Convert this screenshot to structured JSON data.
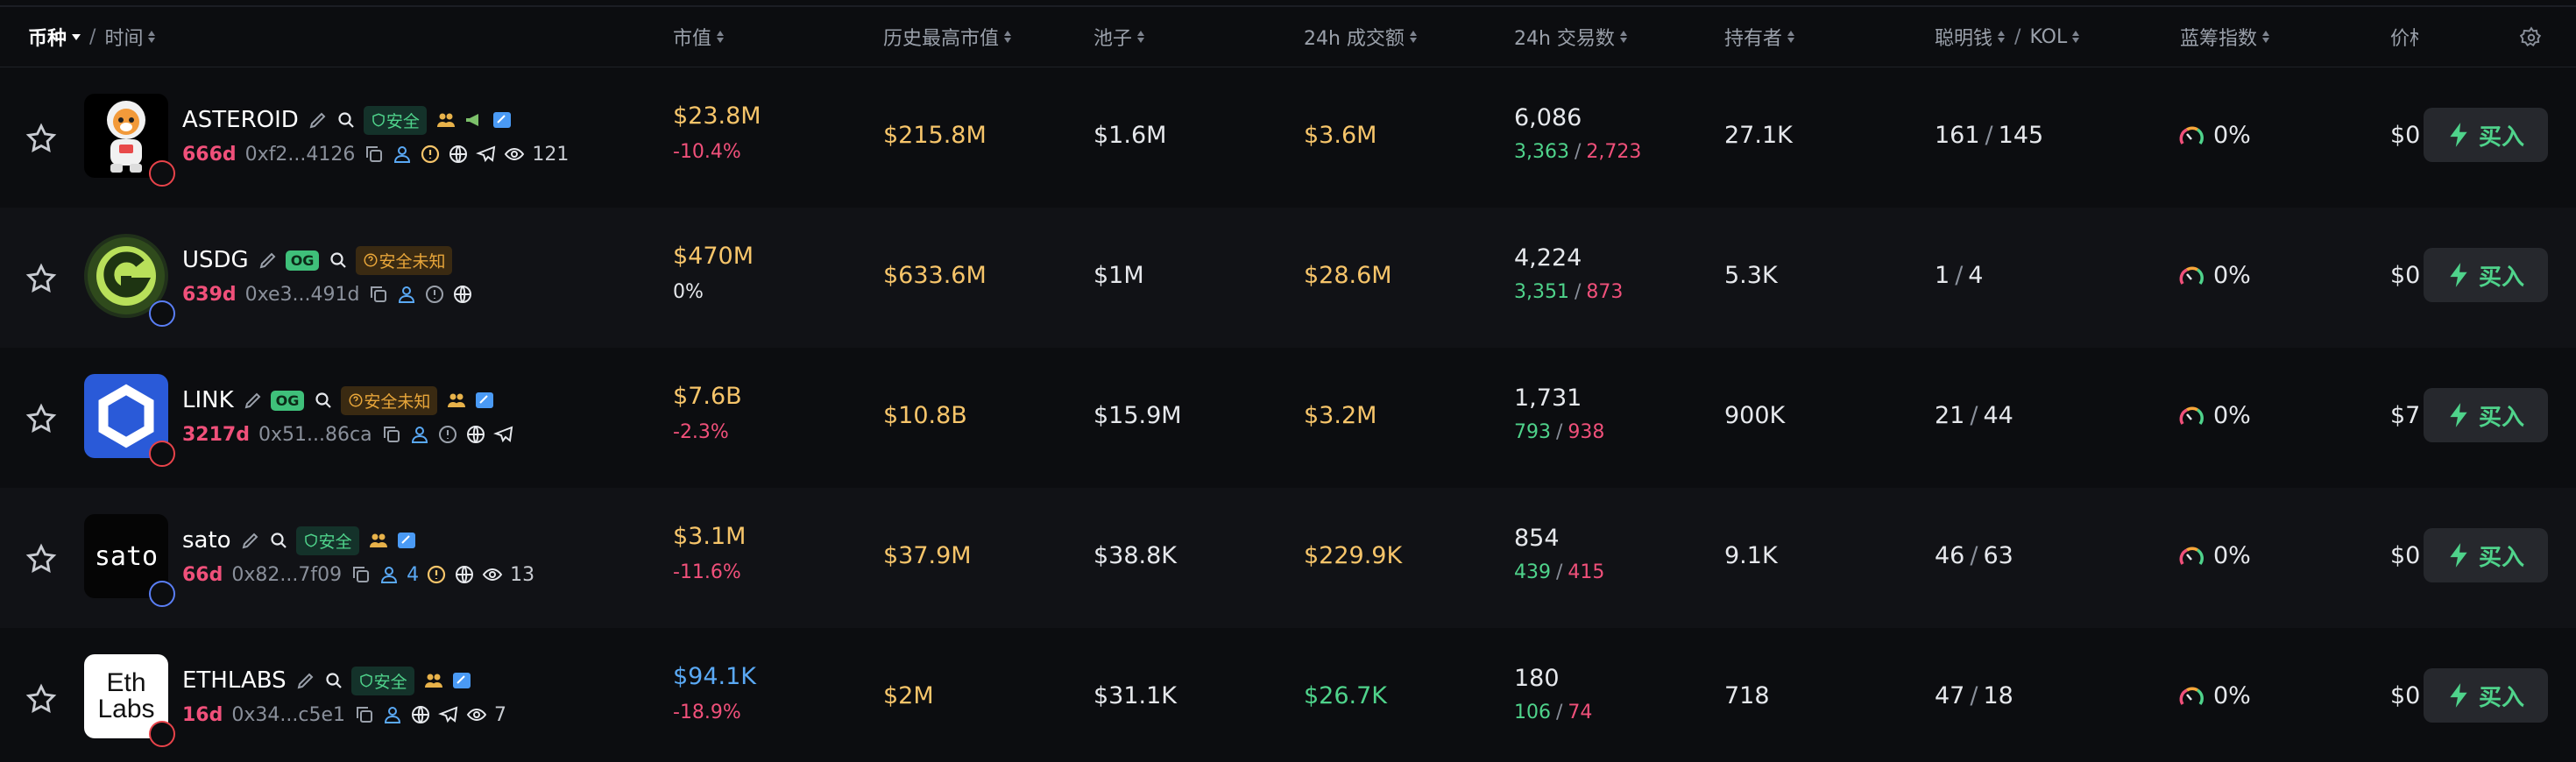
{
  "header": {
    "coin": "币种",
    "time": "时间",
    "market_cap": "市值",
    "ath_market_cap": "历史最高市值",
    "pool": "池子",
    "volume_24h": "24h 成交额",
    "txns_24h": "24h 交易数",
    "holders": "持有者",
    "smart_money": "聪明钱",
    "kol": "KOL",
    "bluechip": "蓝筹指数",
    "price": "价格"
  },
  "buy_label": "买入",
  "safe_label": "安全",
  "unknown_label": "安全未知",
  "og_label": "OG",
  "rows": [
    {
      "symbol": "ASTEROID",
      "age": "666d",
      "address": "0xf2...4126",
      "watchers": "121",
      "market_cap": "$23.8M",
      "change": "-10.4%",
      "ath": "$215.8M",
      "pool": "$1.6M",
      "volume": "$3.6M",
      "txns": "6,086",
      "buys": "3,363",
      "sells": "2,723",
      "holders": "27.1K",
      "smart": "161",
      "kol": "145",
      "bluechip": "0%",
      "price": "$0"
    },
    {
      "symbol": "USDG",
      "age": "639d",
      "address": "0xe3...491d",
      "market_cap": "$470M",
      "change": "0%",
      "ath": "$633.6M",
      "pool": "$1M",
      "volume": "$28.6M",
      "txns": "4,224",
      "buys": "3,351",
      "sells": "873",
      "holders": "5.3K",
      "smart": "1",
      "kol": "4",
      "bluechip": "0%",
      "price": "$0"
    },
    {
      "symbol": "LINK",
      "age": "3217d",
      "address": "0x51...86ca",
      "market_cap": "$7.6B",
      "change": "-2.3%",
      "ath": "$10.8B",
      "pool": "$15.9M",
      "volume": "$3.2M",
      "txns": "1,731",
      "buys": "793",
      "sells": "938",
      "holders": "900K",
      "smart": "21",
      "kol": "44",
      "bluechip": "0%",
      "price": "$7"
    },
    {
      "symbol": "sato",
      "logo_text": "sato",
      "age": "66d",
      "address": "0x82...7f09",
      "users": "4",
      "watchers": "13",
      "market_cap": "$3.1M",
      "change": "-11.6%",
      "ath": "$37.9M",
      "pool": "$38.8K",
      "volume": "$229.9K",
      "txns": "854",
      "buys": "439",
      "sells": "415",
      "holders": "9.1K",
      "smart": "46",
      "kol": "63",
      "bluechip": "0%",
      "price": "$0"
    },
    {
      "symbol": "ETHLABS",
      "logo_line1": "Eth",
      "logo_line2": "Labs",
      "age": "16d",
      "address": "0x34...c5e1",
      "watchers": "7",
      "market_cap": "$94.1K",
      "change": "-18.9%",
      "ath": "$2M",
      "pool": "$31.1K",
      "volume": "$26.7K",
      "txns": "180",
      "buys": "106",
      "sells": "74",
      "holders": "718",
      "smart": "47",
      "kol": "18",
      "bluechip": "0%",
      "price": "$0"
    }
  ],
  "colors": {
    "up": "#4fd38b",
    "down": "#f0507a",
    "accent": "#f7c56a",
    "link": "#5aa9f5"
  }
}
